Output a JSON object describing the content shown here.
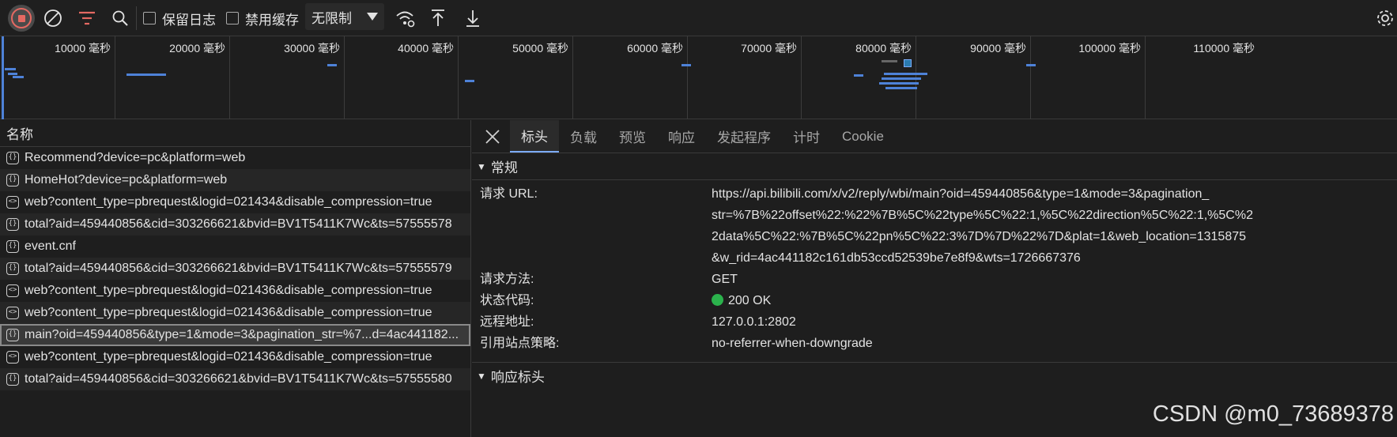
{
  "toolbar": {
    "preserve_log": "保留日志",
    "disable_cache": "禁用缓存",
    "throttle": "无限制"
  },
  "overview": {
    "ticks": [
      "10000 毫秒",
      "20000 毫秒",
      "30000 毫秒",
      "40000 毫秒",
      "50000 毫秒",
      "60000 毫秒",
      "70000 毫秒",
      "80000 毫秒",
      "90000 毫秒",
      "100000 毫秒",
      "110000 毫秒"
    ]
  },
  "list": {
    "header": "名称",
    "rows": [
      "Recommend?device=pc&platform=web",
      "HomeHot?device=pc&platform=web",
      "web?content_type=pbrequest&logid=021434&disable_compression=true",
      "total?aid=459440856&cid=303266621&bvid=BV1T5411K7Wc&ts=57555578",
      "event.cnf",
      "total?aid=459440856&cid=303266621&bvid=BV1T5411K7Wc&ts=57555579",
      "web?content_type=pbrequest&logid=021436&disable_compression=true",
      "web?content_type=pbrequest&logid=021436&disable_compression=true",
      "main?oid=459440856&type=1&mode=3&pagination_str=%7...d=4ac441182...",
      "web?content_type=pbrequest&logid=021436&disable_compression=true",
      "total?aid=459440856&cid=303266621&bvid=BV1T5411K7Wc&ts=57555580"
    ]
  },
  "detail": {
    "tabs": [
      "标头",
      "负载",
      "预览",
      "响应",
      "发起程序",
      "计时",
      "Cookie"
    ],
    "general_title": "常规",
    "request_url_label": "请求 URL:",
    "request_url_lines": [
      "https://api.bilibili.com/x/v2/reply/wbi/main?oid=459440856&type=1&mode=3&pagination_",
      "str=%7B%22offset%22:%22%7B%5C%22type%5C%22:1,%5C%22direction%5C%22:1,%5C%2",
      "2data%5C%22:%7B%5C%22pn%5C%22:3%7D%7D%22%7D&plat=1&web_location=1315875",
      "&w_rid=4ac441182c161db53ccd52539be7e8f9&wts=1726667376"
    ],
    "method_label": "请求方法:",
    "method": "GET",
    "status_label": "状态代码:",
    "status": "200 OK",
    "status_color": "#2bb24c",
    "remote_label": "远程地址:",
    "remote": "127.0.0.1:2802",
    "referrer_label": "引用站点策略:",
    "referrer": "no-referrer-when-downgrade",
    "response_headers_title": "响应标头"
  },
  "watermark": "CSDN @m0_73689378"
}
